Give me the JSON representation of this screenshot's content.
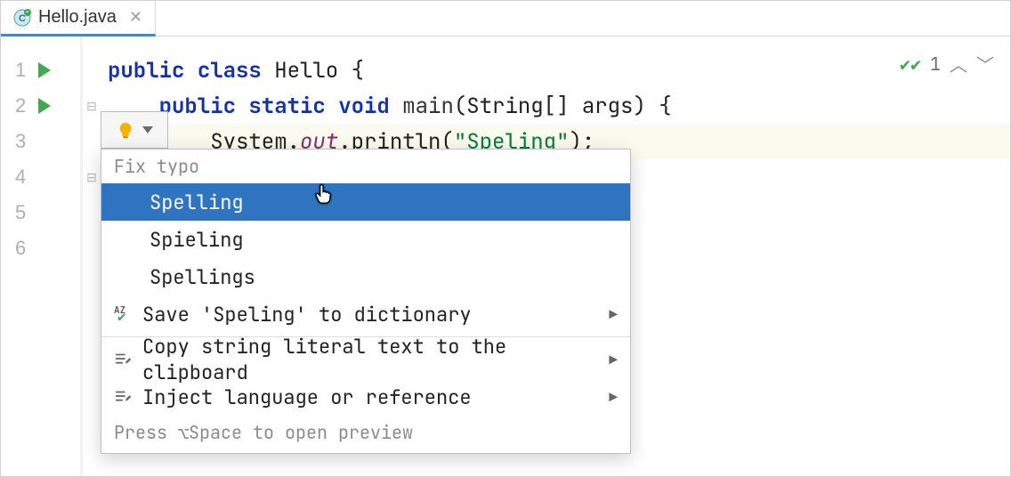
{
  "tab": {
    "filename": "Hello.java"
  },
  "status": {
    "count": "1"
  },
  "gutter": {
    "lines": [
      "1",
      "2",
      "3",
      "4",
      "5",
      "6"
    ]
  },
  "code": {
    "l1": {
      "kw1": "public",
      "kw2": "class",
      "name": " Hello {"
    },
    "l2": {
      "kw1": "public",
      "kw2": "static",
      "kw3": "void",
      "fn": " main",
      "rest1": "(String[] args) {"
    },
    "l3": {
      "sys": "System.",
      "out": "out",
      "rest1": ".println(",
      "q1": "\"",
      "typo": "Speling",
      "q2": "\"",
      "rest2": ");"
    }
  },
  "popup": {
    "header": "Fix typo",
    "items": {
      "opt1": "Spelling",
      "opt2": "Spieling",
      "opt3": "Spellings",
      "save": "Save 'Speling' to dictionary",
      "copy": "Copy string literal text to the clipboard",
      "inject": "Inject language or reference"
    },
    "footer": "Press ⌥Space to open preview"
  }
}
